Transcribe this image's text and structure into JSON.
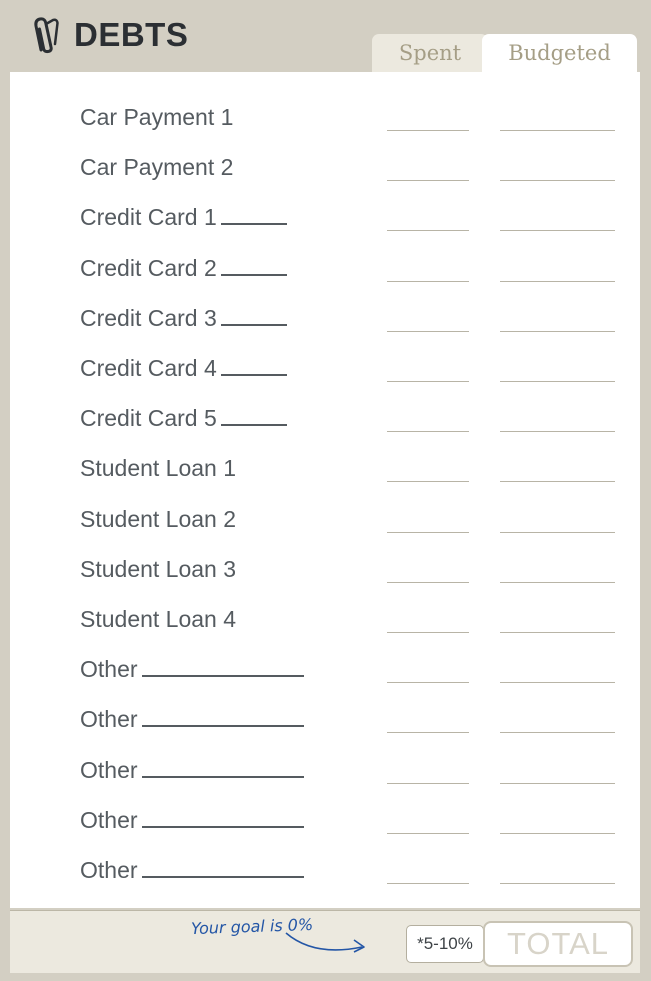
{
  "header": {
    "title": "DEBTS",
    "icon": "paperclip-icon",
    "tabs": {
      "spent": "Spent",
      "budgeted": "Budgeted"
    }
  },
  "rows": [
    {
      "label": "Car Payment 1",
      "blank": false
    },
    {
      "label": "Car Payment 2",
      "blank": false
    },
    {
      "label": "Credit Card 1",
      "blank": true
    },
    {
      "label": "Credit Card 2",
      "blank": true
    },
    {
      "label": "Credit Card 3",
      "blank": true
    },
    {
      "label": "Credit Card 4",
      "blank": true
    },
    {
      "label": "Credit Card 5",
      "blank": true
    },
    {
      "label": "Student Loan 1",
      "blank": false
    },
    {
      "label": "Student Loan 2",
      "blank": false
    },
    {
      "label": "Student Loan 3",
      "blank": false
    },
    {
      "label": "Student Loan 4",
      "blank": false
    },
    {
      "label": "Other",
      "blank": true
    },
    {
      "label": "Other",
      "blank": true
    },
    {
      "label": "Other",
      "blank": true
    },
    {
      "label": "Other",
      "blank": true
    },
    {
      "label": "Other",
      "blank": true
    }
  ],
  "footer": {
    "goal_note": "Your goal is 0%",
    "percent_range": "*5-10%",
    "total_label": "TOTAL"
  },
  "colors": {
    "frame": "#d3cfc3",
    "footer": "#ece9df",
    "text": "#555b60",
    "handwriting": "#2456a6"
  }
}
